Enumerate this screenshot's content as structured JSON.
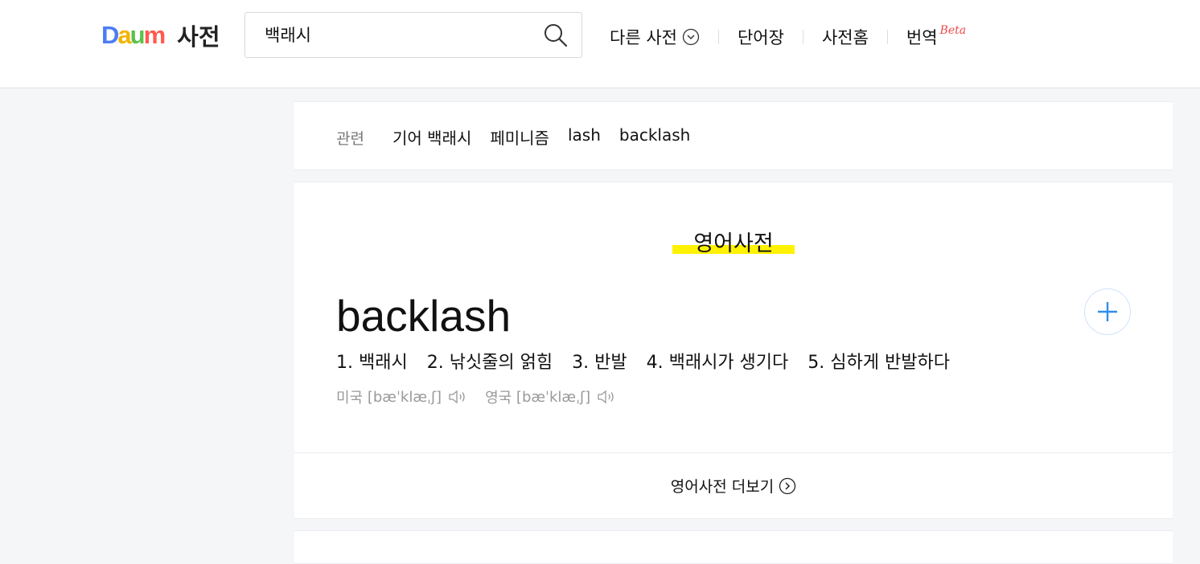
{
  "header": {
    "logo_text": [
      "D",
      "a",
      "u",
      "m"
    ],
    "logo_title": "사전",
    "search": {
      "value": "백래시"
    },
    "nav": {
      "other_dict": "다른 사전",
      "wordbook": "단어장",
      "dict_home": "사전홈",
      "translate": "번역",
      "beta": "Beta"
    }
  },
  "related": {
    "label": "관련",
    "items": [
      "기어 백래시",
      "페미니즘",
      "lash",
      "backlash"
    ]
  },
  "english_dict": {
    "section_title": "영어사전",
    "word": "backlash",
    "meanings": [
      "1. 백래시",
      "2. 낚싯줄의 얽힘",
      "3. 반발",
      "4. 백래시가 생기다",
      "5. 심하게 반발하다"
    ],
    "pronunciation": {
      "us_label": "미국",
      "us": "[bæˈklæˌʃ]",
      "uk_label": "영국",
      "uk": "[bæˈklæˌʃ]"
    },
    "more_label": "영어사전 더보기"
  },
  "colors": {
    "highlight": "#fff200",
    "accent_blue": "#2f8ef0",
    "beta_red": "#f0484a",
    "page_bg": "#f5f6f8"
  }
}
